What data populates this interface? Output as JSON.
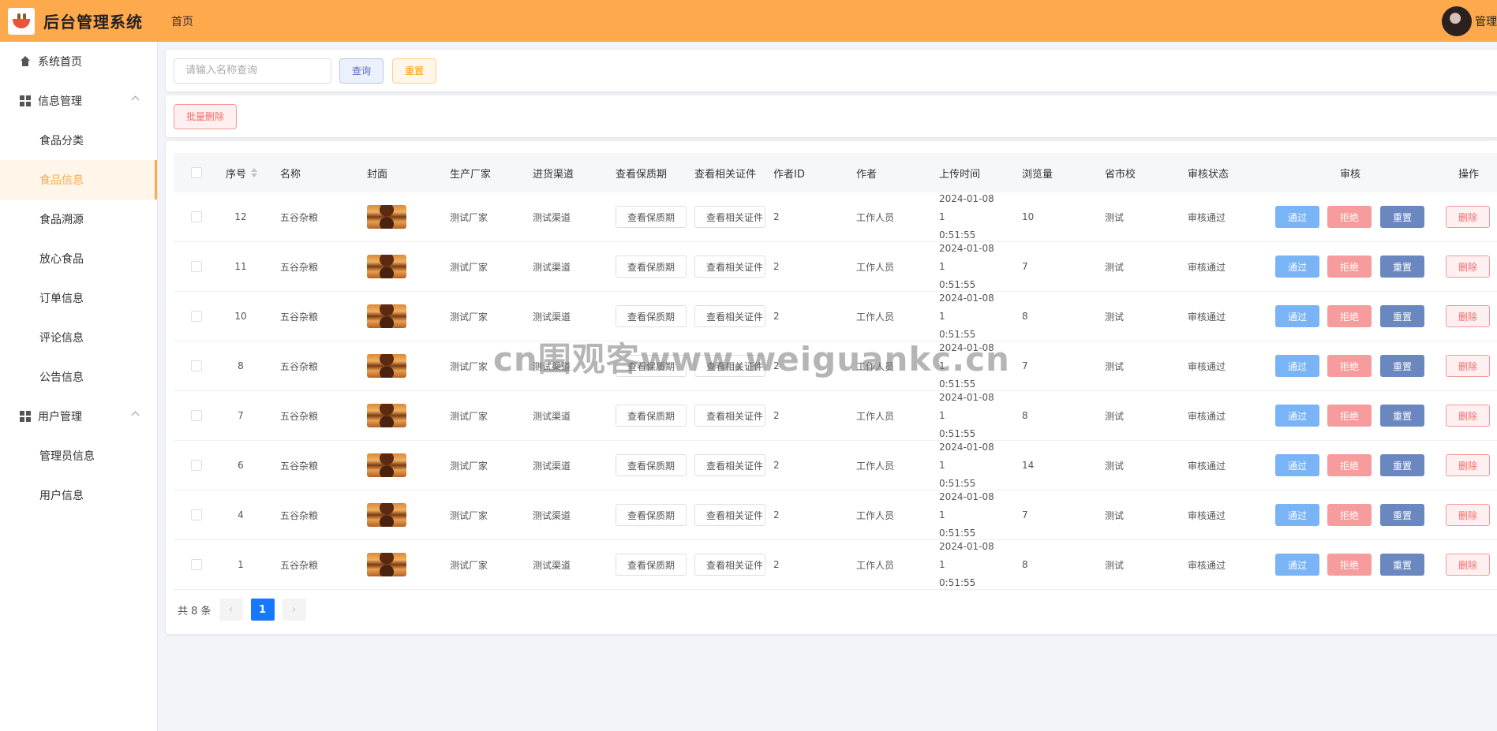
{
  "header": {
    "title": "后台管理系统",
    "breadcrumb": "首页",
    "user_name": "管理"
  },
  "sidebar": {
    "items": [
      {
        "label": "系统首页",
        "icon": "home-icon",
        "level": "top"
      },
      {
        "label": "信息管理",
        "icon": "grid-icon",
        "level": "top",
        "expanded": true
      },
      {
        "label": "食品分类",
        "level": "sub"
      },
      {
        "label": "食品信息",
        "level": "sub",
        "active": true
      },
      {
        "label": "食品溯源",
        "level": "sub"
      },
      {
        "label": "放心食品",
        "level": "sub"
      },
      {
        "label": "订单信息",
        "level": "sub"
      },
      {
        "label": "评论信息",
        "level": "sub"
      },
      {
        "label": "公告信息",
        "level": "sub"
      },
      {
        "label": "用户管理",
        "icon": "grid-icon",
        "level": "top",
        "expanded": true
      },
      {
        "label": "管理员信息",
        "level": "sub"
      },
      {
        "label": "用户信息",
        "level": "sub"
      }
    ]
  },
  "search": {
    "placeholder": "请输入名称查询",
    "query_label": "查询",
    "reset_label": "重置"
  },
  "toolbar": {
    "batch_delete_label": "批量删除"
  },
  "table": {
    "headers": {
      "index": "序号",
      "name": "名称",
      "cover": "封面",
      "maker": "生产厂家",
      "channel": "进货渠道",
      "shelf": "查看保质期",
      "cert": "查看相关证件",
      "author_id": "作者ID",
      "author": "作者",
      "upload_time": "上传时间",
      "views": "浏览量",
      "region": "省市校",
      "status": "审核状态",
      "review": "审核",
      "action": "操作"
    },
    "buttons": {
      "shelf": "查看保质期",
      "cert": "查看相关证件",
      "pass": "通过",
      "reject": "拒绝",
      "rereview": "重置",
      "delete": "删除"
    },
    "rows": [
      {
        "index": "12",
        "name": "五谷杂粮",
        "maker": "测试厂家",
        "channel": "测试渠道",
        "author_id": "2",
        "author": "工作人员",
        "time_line1": "2024-01-08 1",
        "time_line2": "0:51:55",
        "views": "10",
        "region": "测试",
        "status": "审核通过"
      },
      {
        "index": "11",
        "name": "五谷杂粮",
        "maker": "测试厂家",
        "channel": "测试渠道",
        "author_id": "2",
        "author": "工作人员",
        "time_line1": "2024-01-08 1",
        "time_line2": "0:51:55",
        "views": "7",
        "region": "测试",
        "status": "审核通过"
      },
      {
        "index": "10",
        "name": "五谷杂粮",
        "maker": "测试厂家",
        "channel": "测试渠道",
        "author_id": "2",
        "author": "工作人员",
        "time_line1": "2024-01-08 1",
        "time_line2": "0:51:55",
        "views": "8",
        "region": "测试",
        "status": "审核通过"
      },
      {
        "index": "8",
        "name": "五谷杂粮",
        "maker": "测试厂家",
        "channel": "测试渠道",
        "author_id": "2",
        "author": "工作人员",
        "time_line1": "2024-01-08 1",
        "time_line2": "0:51:55",
        "views": "7",
        "region": "测试",
        "status": "审核通过"
      },
      {
        "index": "7",
        "name": "五谷杂粮",
        "maker": "测试厂家",
        "channel": "测试渠道",
        "author_id": "2",
        "author": "工作人员",
        "time_line1": "2024-01-08 1",
        "time_line2": "0:51:55",
        "views": "8",
        "region": "测试",
        "status": "审核通过"
      },
      {
        "index": "6",
        "name": "五谷杂粮",
        "maker": "测试厂家",
        "channel": "测试渠道",
        "author_id": "2",
        "author": "工作人员",
        "time_line1": "2024-01-08 1",
        "time_line2": "0:51:55",
        "views": "14",
        "region": "测试",
        "status": "审核通过"
      },
      {
        "index": "4",
        "name": "五谷杂粮",
        "maker": "测试厂家",
        "channel": "测试渠道",
        "author_id": "2",
        "author": "工作人员",
        "time_line1": "2024-01-08 1",
        "time_line2": "0:51:55",
        "views": "7",
        "region": "测试",
        "status": "审核通过"
      },
      {
        "index": "1",
        "name": "五谷杂粮",
        "maker": "测试厂家",
        "channel": "测试渠道",
        "author_id": "2",
        "author": "工作人员",
        "time_line1": "2024-01-08 1",
        "time_line2": "0:51:55",
        "views": "8",
        "region": "测试",
        "status": "审核通过"
      }
    ]
  },
  "pagination": {
    "total_text": "共 8 条",
    "current_page": "1",
    "prev_icon": "chevron-left-icon",
    "next_icon": "chevron-right-icon"
  },
  "watermark": "cn围观客www.weiguankc.cn",
  "colors": {
    "header_bg": "#ffa94d",
    "accent": "#ffa94d",
    "pass": "#79b4f6",
    "reject": "#f79c9c",
    "rereview": "#6b87c0",
    "danger": "#f56c6c",
    "page_active": "#1677ff"
  }
}
